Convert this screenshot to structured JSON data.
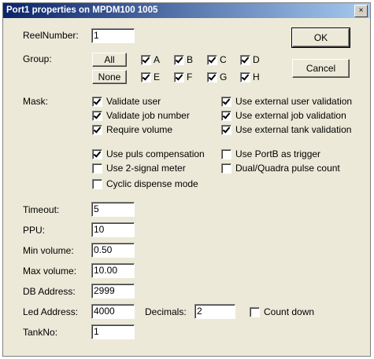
{
  "window": {
    "title": "Port1 properties on MPDM100 1005",
    "close_glyph": "×"
  },
  "reel": {
    "label": "ReelNumber:",
    "value": "1"
  },
  "ok_label": "OK",
  "cancel_label": "Cancel",
  "group": {
    "label": "Group:",
    "all_label": "All",
    "none_label": "None",
    "items": [
      {
        "label": "A",
        "checked": true
      },
      {
        "label": "B",
        "checked": true
      },
      {
        "label": "C",
        "checked": true
      },
      {
        "label": "D",
        "checked": true
      },
      {
        "label": "E",
        "checked": true
      },
      {
        "label": "F",
        "checked": true
      },
      {
        "label": "G",
        "checked": true
      },
      {
        "label": "H",
        "checked": true
      }
    ]
  },
  "mask": {
    "label": "Mask:",
    "options": [
      {
        "label": "Validate user",
        "checked": true
      },
      {
        "label": "Use external user validation",
        "checked": true
      },
      {
        "label": "Validate job number",
        "checked": true
      },
      {
        "label": "Use external job validation",
        "checked": true
      },
      {
        "label": "Require volume",
        "checked": true
      },
      {
        "label": "Use external tank validation",
        "checked": true
      },
      {
        "label": "Use puls compensation",
        "checked": true
      },
      {
        "label": "Use PortB as trigger",
        "checked": false
      },
      {
        "label": "Use 2-signal meter",
        "checked": false
      },
      {
        "label": "Dual/Quadra pulse count",
        "checked": false
      },
      {
        "label": "Cyclic dispense mode",
        "checked": false
      }
    ]
  },
  "fields": {
    "timeout": {
      "label": "Timeout:",
      "value": "5"
    },
    "ppu": {
      "label": "PPU:",
      "value": "10"
    },
    "min_volume": {
      "label": "Min volume:",
      "value": "0.50"
    },
    "max_volume": {
      "label": "Max volume:",
      "value": "10.00"
    },
    "db_address": {
      "label": "DB Address:",
      "value": "2999"
    },
    "led_address": {
      "label": "Led Address:",
      "value": "4000"
    },
    "decimals": {
      "label": "Decimals:",
      "value": "2"
    },
    "tankno": {
      "label": "TankNo:",
      "value": "1"
    }
  },
  "count_down": {
    "label": "Count down",
    "checked": false
  }
}
